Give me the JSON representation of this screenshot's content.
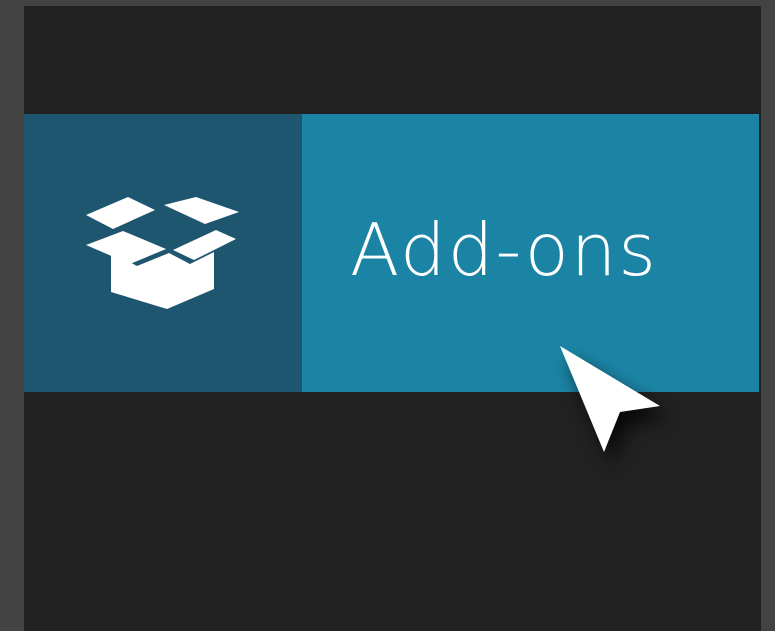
{
  "addons": {
    "label": "Add-ons",
    "icon": "open-box-icon"
  },
  "cursor": {
    "icon": "mouse-pointer-icon"
  },
  "colors": {
    "window_frame": "#434343",
    "panel_background": "#222122",
    "icon_tile": "#1f566f",
    "label_tile": "#1b84a4",
    "foreground": "#ffffff"
  }
}
